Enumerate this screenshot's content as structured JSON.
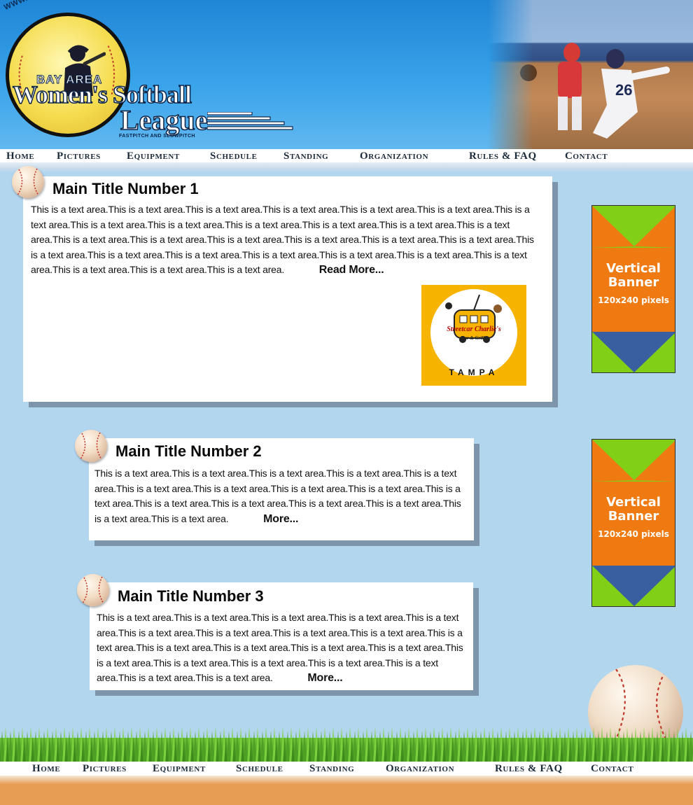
{
  "header": {
    "site_url": "WWW.TAMPABAYSOFTBALL.ORG",
    "logo_bay_area": "BAY AREA",
    "logo_womens": "Women's Softball",
    "logo_league": "League",
    "logo_subtitle": "FASTPITCH AND SLOWPITCH"
  },
  "nav": {
    "items": [
      "Home",
      "Pictures",
      "Equipment",
      "Schedule",
      "Standing",
      "Organization",
      "Rules & FAQ",
      "Contact"
    ]
  },
  "articles": [
    {
      "title": "Main Title Number 1",
      "body": "This is a text area.This is a text area.This is a text area.This is a text area.This is a text area.This is a text area.This is a text area.This is a text area.This is a text area.This is a text area.This is a text area.This is a text area.This is a text area.This is a text area.This is a text area.This is a text area.This is a text area.This is a text area.This is a text area.This is a text area.This is a text area.This is a text area.This is a text area.This is a text area.This is a text area.This is a text area.This is a text area.This is a text area.This is a text area.",
      "more": "Read More..."
    },
    {
      "title": "Main Title Number 2",
      "body": "This is a text area.This is a text area.This is a text area.This is a text area.This is a text area.This is a text area.This is a text area.This is a text area.This is a text area.This is a text area.This is a text area.This is a text area.This is a text area.This is a text area.This is a text area.This is a text area.",
      "more": "More..."
    },
    {
      "title": "Main Title Number 3",
      "body": "This is a text area.This is a text area.This is a text area.This is a text area.This is a text area.This is a text area.This is a text area.This is a text area.This is a text area.This is a text area.This is a text area.This is a text area.This is a text area.This is a text area.This is a text area.This is a text area.This is a text area.This is a text area.This is a text area.This is a text area.This is a text area.",
      "more": "More..."
    }
  ],
  "sponsor": {
    "name": "Streetcar Charlie's",
    "tagline": "Bar & Grille",
    "city": "TAMPA"
  },
  "banners": [
    {
      "title": "Vertical Banner",
      "size": "120x240 pixels"
    },
    {
      "title": "Vertical Banner",
      "size": "120x240 pixels"
    }
  ],
  "colors": {
    "page_bg": "#b3d6ef",
    "header_blue": "#1f86d6",
    "banner_orange": "#ef7a12",
    "banner_green": "#82cf18",
    "banner_blue": "#3a5fa0",
    "footer_orange": "#e89d54",
    "sponsor_yellow": "#f6b300"
  },
  "icons": [
    "softball-icon",
    "logo-emblem",
    "grass-strip",
    "big-softball"
  ]
}
